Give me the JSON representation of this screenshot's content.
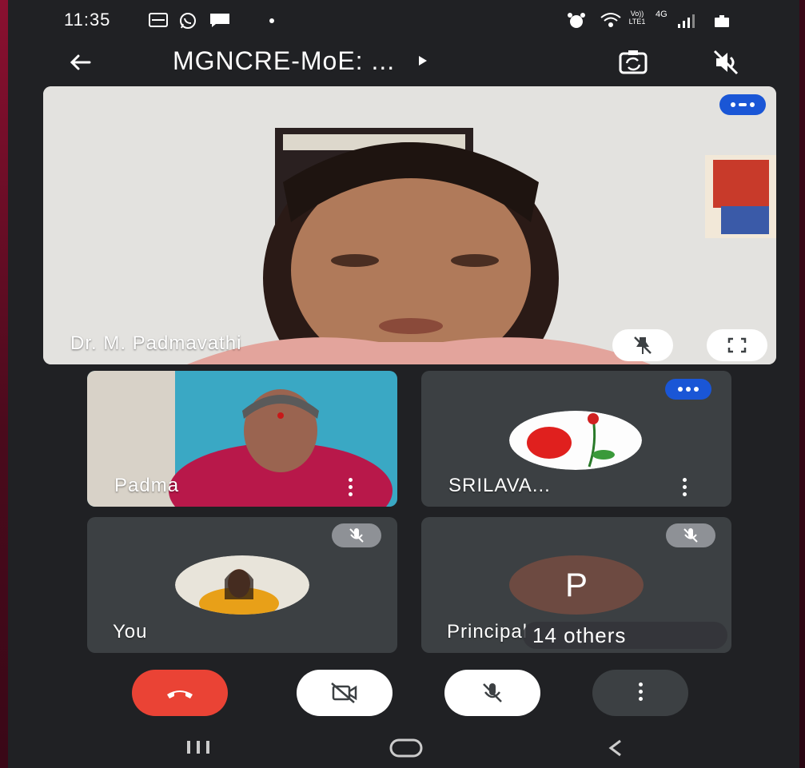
{
  "status_bar": {
    "time": "11:35",
    "left_icons": [
      "gallery-icon",
      "whatsapp-icon",
      "message-icon",
      "dot-icon"
    ],
    "right_icons": [
      "alarm-icon",
      "wifi-icon",
      "volte-icon",
      "4g-icon",
      "signal-icon",
      "battery-icon"
    ],
    "volte_label": "Vo)) LTE1",
    "network_label": "4G"
  },
  "app_bar": {
    "title": "MGNCRE-MoE: ...",
    "back_icon": "arrow-back-icon",
    "switch_camera_icon": "switch-camera-icon",
    "speaker_icon": "speaker-off-icon"
  },
  "main_speaker": {
    "name": "Dr. M. Padmavathi",
    "speaking": true
  },
  "participants": [
    {
      "name": "Padma",
      "type": "video",
      "speaking": false
    },
    {
      "name": "SRILAVA...",
      "type": "avatar-image",
      "speaking": true
    },
    {
      "name": "You",
      "type": "avatar-image",
      "muted": true
    },
    {
      "name": "Principal",
      "type": "initial",
      "initial": "P",
      "muted": true
    }
  ],
  "others": {
    "label": "14 others"
  },
  "controls": [
    "end-call",
    "camera-off",
    "mic-off",
    "more-options"
  ],
  "nav": [
    "recent-apps",
    "home",
    "back"
  ],
  "colors": {
    "background": "#202124",
    "tile": "#3c4043",
    "end_call": "#ea4335",
    "speaking_badge": "#1a56d6",
    "principal_avatar": "#6d4a41"
  }
}
